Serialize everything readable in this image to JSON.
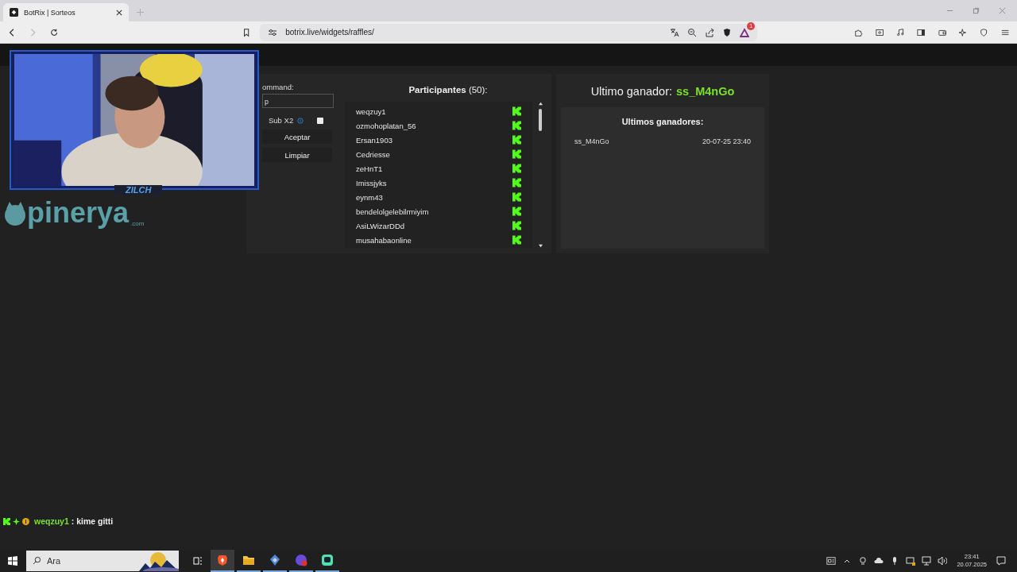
{
  "browser": {
    "tabs": [
      {
        "title": "BotRix | Sorteos",
        "selected": true
      }
    ],
    "address": "botrix.live/widgets/raffles/",
    "rewards_badge": "1"
  },
  "raffle": {
    "command_label": "ommand:",
    "command_value": "p",
    "sub_label": "Sub X2",
    "sub_checked": false,
    "buttons": [
      "Aceptar",
      "Limpiar"
    ],
    "participants_title": "**Participantes** (50):",
    "participants": [
      "weqzuy1",
      "ozmohoplatan_56",
      "Ersan1903",
      "Cedriesse",
      "zeHnT1",
      "Imissjyks",
      "eynm43",
      "bendelolgelebilrmiyim",
      "AsiLWizarDDd",
      "musahabaonline"
    ]
  },
  "winner": {
    "label": "Ultimo ganador:",
    "name": "ss_M4nGo",
    "history_title": "Ultimos ganadores:",
    "history": [
      {
        "name": "ss_M4nGo",
        "time": "20-07-25 23:40"
      }
    ]
  },
  "overlay": {
    "cam_label": "ZILCH",
    "logo": "pinerya",
    "logo_suffix": ".com"
  },
  "chat": {
    "user": "weqzuy1",
    "message": ": kime gitti"
  },
  "taskbar": {
    "search_placeholder": "Ara",
    "apps": [
      {
        "kind": "brave",
        "selected": true
      },
      {
        "kind": "folder",
        "selected": false
      },
      {
        "kind": "cube",
        "selected": false
      },
      {
        "kind": "chat",
        "selected": false
      },
      {
        "kind": "stream",
        "selected": false
      }
    ],
    "time": "23:41",
    "date": "20.07.2025"
  }
}
